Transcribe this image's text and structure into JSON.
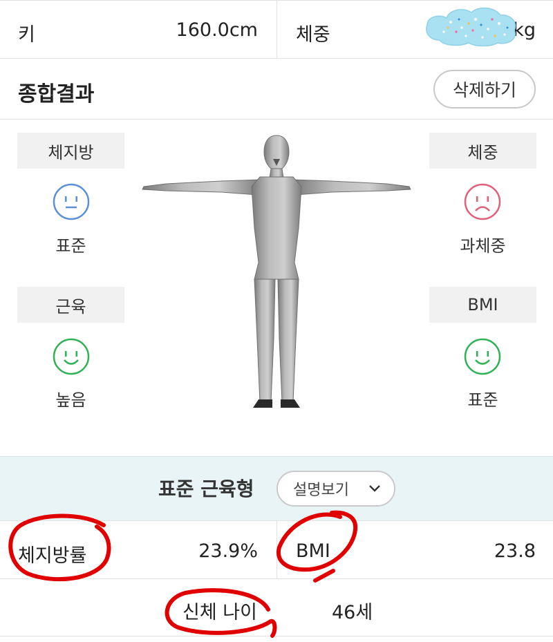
{
  "top": {
    "height_label": "키",
    "height_value": "160.0cm",
    "weight_label": "체중",
    "weight_value_visible": "0kg"
  },
  "summary": {
    "title": "종합결과",
    "delete_label": "삭제하기"
  },
  "cards": [
    {
      "label": "체지방",
      "status": "표준",
      "face": "neutral",
      "color": "#5b8fd6"
    },
    {
      "label": "체중",
      "status": "과체중",
      "face": "sad",
      "color": "#e0607a"
    },
    {
      "label": "근육",
      "status": "높음",
      "face": "happy",
      "color": "#2fb156"
    },
    {
      "label": "BMI",
      "status": "표준",
      "face": "happy",
      "color": "#2fb156"
    }
  ],
  "body_type": {
    "label": "표준 근육형",
    "explain_label": "설명보기"
  },
  "metrics": {
    "body_fat_label": "체지방률",
    "body_fat_value": "23.9%",
    "bmi_label": "BMI",
    "bmi_value": "23.8",
    "body_age_label": "신체 나이",
    "body_age_value": "46세"
  },
  "colors": {
    "divider": "#e2e2e2",
    "band": "#e9f4f7",
    "annotation": "#e00000"
  },
  "icons": [
    "neutral-face-icon",
    "sad-face-icon",
    "happy-face-icon",
    "chevron-down-icon",
    "human-figure"
  ]
}
